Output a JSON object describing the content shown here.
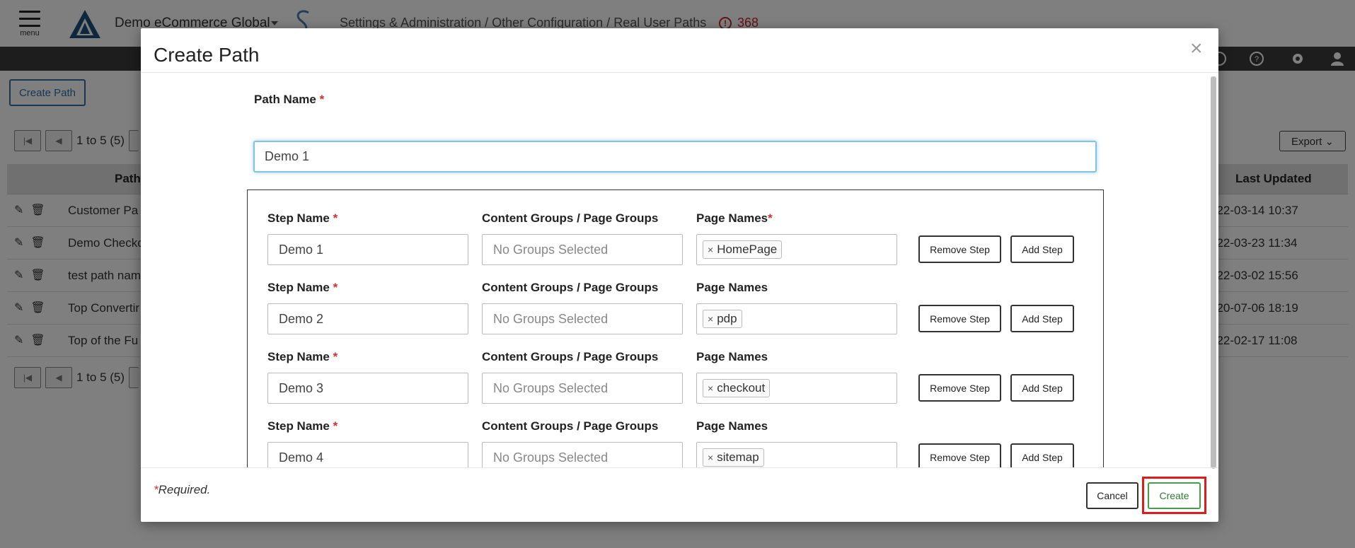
{
  "header": {
    "menu_label": "menu",
    "app_name": "Demo eCommerce Global",
    "breadcrumb": "Settings & Administration / Other Configuration / Real User Paths",
    "alert_count": "368",
    "alert_icon_glyph": "!"
  },
  "page": {
    "create_path_button": "Create Path",
    "export_button": "Export",
    "pager_text": "1 to 5 (5)",
    "columns": {
      "path": "Path",
      "last_updated": "Last Updated"
    },
    "rows": [
      {
        "name": "Customer Pa",
        "updated": "022-03-14 10:37"
      },
      {
        "name": "Demo Checko",
        "updated": "022-03-23 11:34"
      },
      {
        "name": "test path nam",
        "updated": "022-03-02 15:56"
      },
      {
        "name": "Top Convertir",
        "updated": "020-07-06 18:19"
      },
      {
        "name": "Top of the Fu",
        "updated": "022-02-17 11:08"
      }
    ]
  },
  "modal": {
    "title": "Create Path",
    "close_glyph": "×",
    "path_name_label": "Path Name ",
    "path_name_value": "Demo 1",
    "required_mark": "*",
    "step_name_label": "Step Name ",
    "groups_label": "Content Groups / Page Groups",
    "groups_placeholder": "No Groups Selected",
    "page_names_label": "Page Names",
    "remove_step_button": "Remove Step",
    "add_step_button": "Add Step",
    "tag_remove_glyph": "×",
    "steps": [
      {
        "name": "Demo 1",
        "page": "HomePage",
        "page_required": "*"
      },
      {
        "name": "Demo 2",
        "page": "pdp",
        "page_required": ""
      },
      {
        "name": "Demo 3",
        "page": "checkout",
        "page_required": ""
      },
      {
        "name": "Demo 4",
        "page": "sitemap",
        "page_required": ""
      }
    ],
    "required_note": "Required.",
    "cancel_button": "Cancel",
    "create_button": "Create"
  },
  "colors": {
    "primary": "#2f6fa5",
    "required": "#d32f2f",
    "create": "#43a047",
    "highlight": "#e01b1b",
    "topbar_dark": "#3b3b3b"
  }
}
